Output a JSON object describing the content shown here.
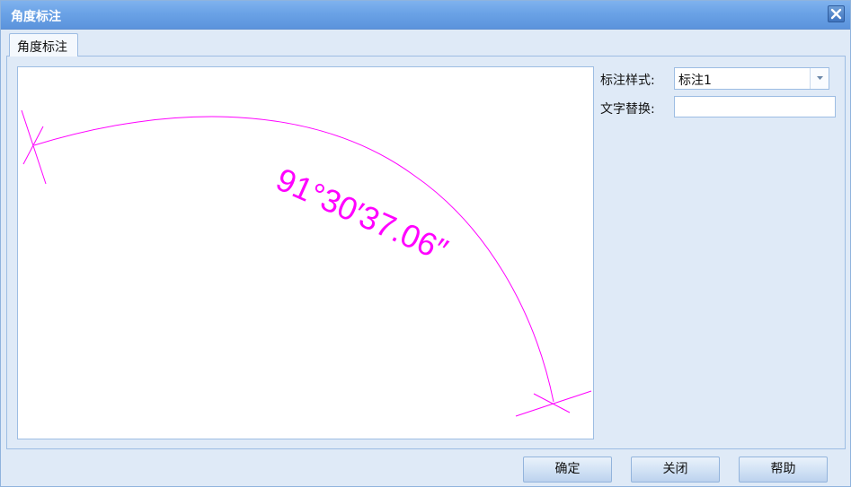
{
  "window": {
    "title": "角度标注"
  },
  "tabs": [
    {
      "label": "角度标注"
    }
  ],
  "preview": {
    "dimension_text": "91°30′37.06″",
    "color": "#ff00ff"
  },
  "form": {
    "style_label": "标注样式:",
    "style_value": "标注1",
    "override_label": "文字替换:",
    "override_value": ""
  },
  "buttons": {
    "ok": "确定",
    "close": "关闭",
    "help": "帮助"
  },
  "icons": {
    "close": "close-icon",
    "dropdown": "chevron-down-icon"
  }
}
